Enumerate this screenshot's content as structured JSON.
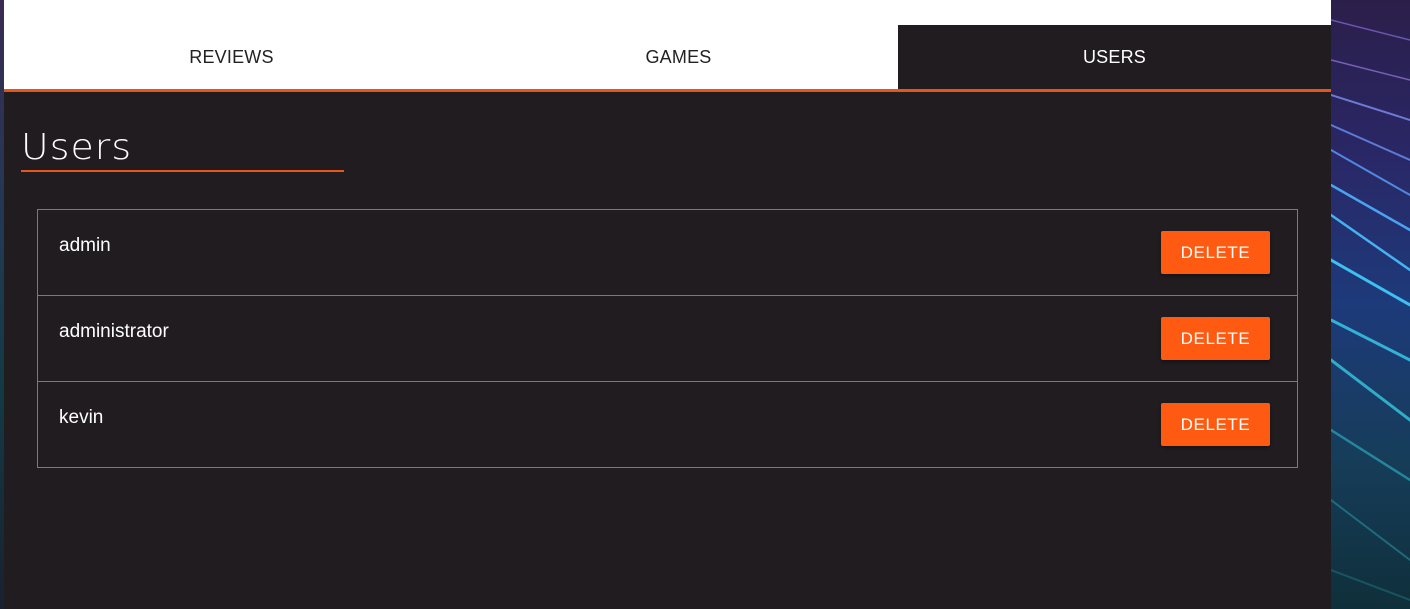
{
  "tabs": [
    {
      "label": "REVIEWS",
      "active": false
    },
    {
      "label": "GAMES",
      "active": false
    },
    {
      "label": "USERS",
      "active": true
    }
  ],
  "page": {
    "title": "Users"
  },
  "users": [
    {
      "name": "admin",
      "action_label": "DELETE"
    },
    {
      "name": "administrator",
      "action_label": "DELETE"
    },
    {
      "name": "kevin",
      "action_label": "DELETE"
    }
  ],
  "colors": {
    "accent": "#ff5a12",
    "panel_bg": "#211c1f",
    "tabbar_bg": "#ffffff"
  }
}
